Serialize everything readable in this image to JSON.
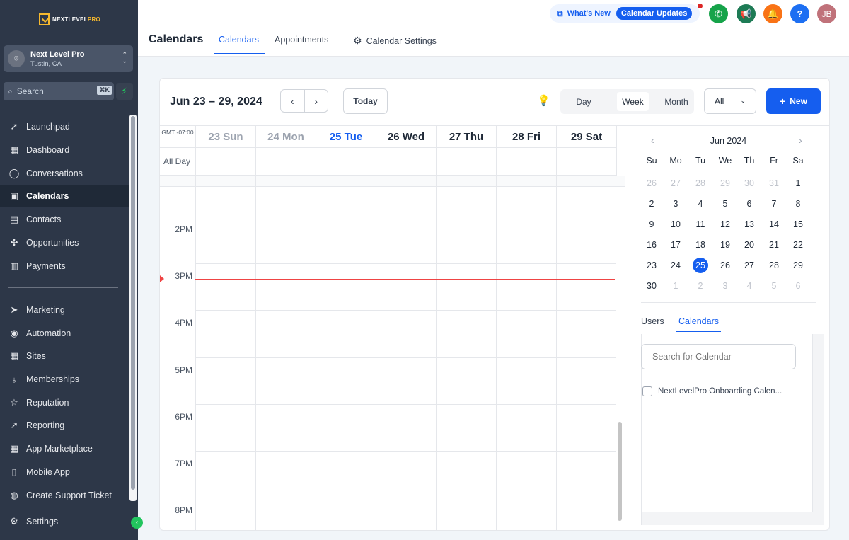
{
  "sidebar": {
    "logo_main": "NEXTLEVEL",
    "logo_accent": "PRO",
    "account_name": "Next Level Pro",
    "account_location": "Tustin, CA",
    "search_placeholder": "Search",
    "search_shortcut": "⌘K",
    "items": [
      {
        "label": "Launchpad",
        "icon": "rocket-icon"
      },
      {
        "label": "Dashboard",
        "icon": "grid-icon"
      },
      {
        "label": "Conversations",
        "icon": "chat-icon"
      },
      {
        "label": "Calendars",
        "icon": "calendar-icon",
        "active": true
      },
      {
        "label": "Contacts",
        "icon": "contacts-icon"
      },
      {
        "label": "Opportunities",
        "icon": "opportunities-icon"
      },
      {
        "label": "Payments",
        "icon": "payments-icon"
      },
      {
        "label": "Marketing",
        "icon": "send-icon"
      },
      {
        "label": "Automation",
        "icon": "automation-icon"
      },
      {
        "label": "Sites",
        "icon": "sites-icon"
      },
      {
        "label": "Memberships",
        "icon": "medal-icon"
      },
      {
        "label": "Reputation",
        "icon": "star-icon"
      },
      {
        "label": "Reporting",
        "icon": "chart-icon"
      },
      {
        "label": "App Marketplace",
        "icon": "apps-icon"
      },
      {
        "label": "Mobile App",
        "icon": "phone-icon"
      },
      {
        "label": "Create Support Ticket",
        "icon": "support-icon"
      },
      {
        "label": "Settings",
        "icon": "gear-icon"
      }
    ]
  },
  "header": {
    "page_title": "Calendars",
    "tabs": [
      "Calendars",
      "Appointments",
      "Calendar Settings"
    ],
    "whats_new": "What's New",
    "calendar_updates": "Calendar Updates",
    "avatar_initials": "JB",
    "help": "?"
  },
  "toolbar": {
    "date_range": "Jun 23 – 29, 2024",
    "today_label": "Today",
    "views": [
      "Day",
      "Week",
      "Month"
    ],
    "active_view": "Week",
    "filter_value": "All",
    "new_label": "New"
  },
  "week": {
    "timezone": "GMT -07:00",
    "all_day_label": "All Day",
    "days": [
      {
        "label": "23 Sun",
        "state": "past"
      },
      {
        "label": "24 Mon",
        "state": "past"
      },
      {
        "label": "25 Tue",
        "state": "today"
      },
      {
        "label": "26 Wed",
        "state": "future"
      },
      {
        "label": "27 Thu",
        "state": "future"
      },
      {
        "label": "28 Fri",
        "state": "future"
      },
      {
        "label": "29 Sat",
        "state": "future"
      }
    ],
    "hours": [
      "2PM",
      "3PM",
      "4PM",
      "5PM",
      "6PM",
      "7PM",
      "8PM"
    ]
  },
  "mini_calendar": {
    "title": "Jun 2024",
    "weekdays": [
      "Su",
      "Mo",
      "Tu",
      "We",
      "Th",
      "Fr",
      "Sa"
    ],
    "weeks": [
      [
        [
          "26",
          1
        ],
        [
          "27",
          1
        ],
        [
          "28",
          1
        ],
        [
          "29",
          1
        ],
        [
          "30",
          1
        ],
        [
          "31",
          1
        ],
        [
          "1",
          0
        ]
      ],
      [
        [
          "2",
          0
        ],
        [
          "3",
          0
        ],
        [
          "4",
          0
        ],
        [
          "5",
          0
        ],
        [
          "6",
          0
        ],
        [
          "7",
          0
        ],
        [
          "8",
          0
        ]
      ],
      [
        [
          "9",
          0
        ],
        [
          "10",
          0
        ],
        [
          "11",
          0
        ],
        [
          "12",
          0
        ],
        [
          "13",
          0
        ],
        [
          "14",
          0
        ],
        [
          "15",
          0
        ]
      ],
      [
        [
          "16",
          0
        ],
        [
          "17",
          0
        ],
        [
          "18",
          0
        ],
        [
          "19",
          0
        ],
        [
          "20",
          0
        ],
        [
          "21",
          0
        ],
        [
          "22",
          0
        ]
      ],
      [
        [
          "23",
          0
        ],
        [
          "24",
          0
        ],
        [
          "25",
          2
        ],
        [
          "26",
          0
        ],
        [
          "27",
          0
        ],
        [
          "28",
          0
        ],
        [
          "29",
          0
        ]
      ],
      [
        [
          "30",
          0
        ],
        [
          "1",
          1
        ],
        [
          "2",
          1
        ],
        [
          "3",
          1
        ],
        [
          "4",
          1
        ],
        [
          "5",
          1
        ],
        [
          "6",
          1
        ]
      ]
    ]
  },
  "panel": {
    "tabs": [
      "Users",
      "Calendars"
    ],
    "active_tab": "Calendars",
    "search_placeholder": "Search for Calendar",
    "calendars": [
      "NextLevelPro Onboarding Calen..."
    ]
  },
  "colors": {
    "sidebar_bg": "#2d3748",
    "accent": "#155eef",
    "now_line": "#ef4444",
    "phone_btn": "#16a34a",
    "megaphone_btn": "#1e7b55",
    "bell_btn": "#f97316",
    "help_btn": "#1d6ff2",
    "avatar_bg": "#c0727a"
  }
}
